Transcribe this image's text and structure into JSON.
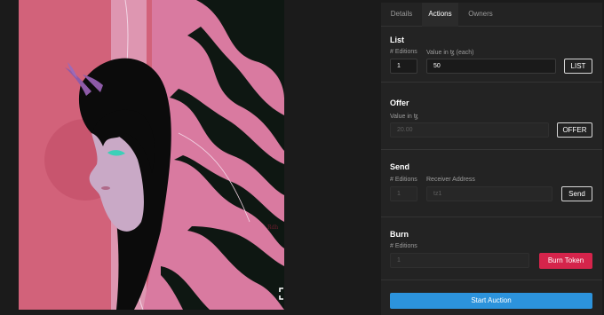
{
  "artwork": {
    "alt": "Artwork: girl with horns and pink flowing hair",
    "signature": "Rdh",
    "fullscreen_icon": "expand-icon"
  },
  "tabs": [
    {
      "label": "Details",
      "active": false
    },
    {
      "label": "Actions",
      "active": true
    },
    {
      "label": "Owners",
      "active": false
    }
  ],
  "list": {
    "title": "List",
    "editions_label": "# Editions",
    "editions_value": "1",
    "value_label": "Value in ꜩ (each)",
    "value_value": "50",
    "button": "LIST"
  },
  "offer": {
    "title": "Offer",
    "value_label": "Value in ꜩ",
    "value_placeholder": "20.00",
    "button": "OFFER"
  },
  "send": {
    "title": "Send",
    "editions_label": "# Editions",
    "editions_placeholder": "1",
    "receiver_label": "Receiver Address",
    "receiver_placeholder": "tz1",
    "button": "Send"
  },
  "burn": {
    "title": "Burn",
    "editions_label": "# Editions",
    "editions_placeholder": "1",
    "button": "Burn Token"
  },
  "auction": {
    "button": "Start Auction"
  },
  "colors": {
    "accent_blue": "#2c93dc",
    "burn_red": "#d5244b",
    "art_pink": "#d2627a"
  }
}
